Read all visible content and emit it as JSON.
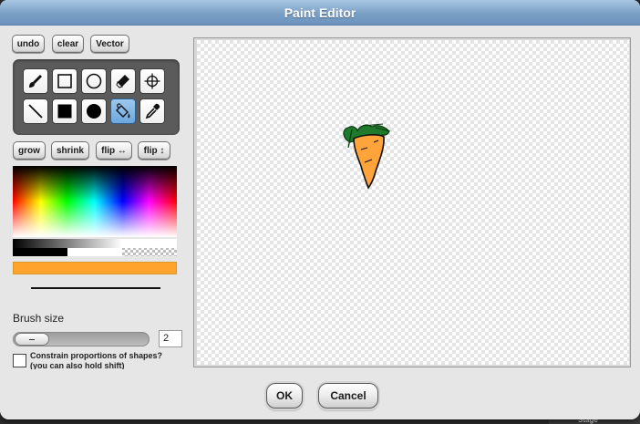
{
  "dialog": {
    "title": "Paint Editor"
  },
  "toolbar": {
    "undo_label": "undo",
    "clear_label": "clear",
    "vector_label": "Vector"
  },
  "tools": [
    {
      "name": "brush",
      "icon": "brush-icon",
      "selected": false
    },
    {
      "name": "rectangle",
      "icon": "rectangle-outline-icon",
      "selected": false
    },
    {
      "name": "ellipse",
      "icon": "ellipse-outline-icon",
      "selected": false
    },
    {
      "name": "eraser",
      "icon": "eraser-icon",
      "selected": false
    },
    {
      "name": "rotation-center",
      "icon": "crosshair-icon",
      "selected": false
    },
    {
      "name": "line",
      "icon": "line-icon",
      "selected": false
    },
    {
      "name": "filled-rectangle",
      "icon": "rectangle-filled-icon",
      "selected": false
    },
    {
      "name": "filled-ellipse",
      "icon": "ellipse-filled-icon",
      "selected": false
    },
    {
      "name": "paint-bucket",
      "icon": "paint-bucket-icon",
      "selected": true
    },
    {
      "name": "pipette",
      "icon": "pipette-icon",
      "selected": false
    }
  ],
  "transform": {
    "grow_label": "grow",
    "shrink_label": "shrink",
    "flip_h_label": "flip ↔",
    "flip_v_label": "flip ↕"
  },
  "colors": {
    "current": "#FFA32C",
    "title_bar": "#7aa0c6"
  },
  "brush": {
    "label": "Brush size",
    "value": "2"
  },
  "constrain": {
    "line1": "Constrain proportions of shapes?",
    "line2": "(you can also hold shift)",
    "checked": false
  },
  "actions": {
    "ok_label": "OK",
    "cancel_label": "Cancel"
  },
  "background": {
    "stage_label": "Stage"
  }
}
